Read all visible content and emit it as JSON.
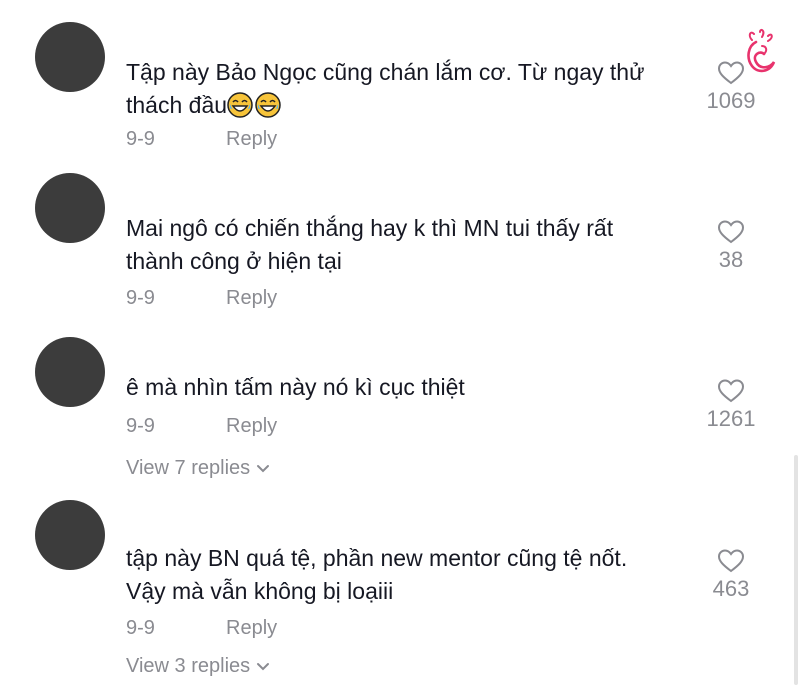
{
  "comments": [
    {
      "text": "Tập này Bảo Ngọc cũng chán lắm cơ. Từ ngay thử\nthách đầu",
      "emojis": [
        "tears-of-joy-emoji",
        "tears-of-joy-emoji"
      ],
      "date": "9-9",
      "reply_label": "Reply",
      "likes": "1069",
      "heart_icon": "heart-outline-icon"
    },
    {
      "text": "Mai ngô có chiến thắng hay k thì MN tui thấy rất\nthành công ở hiện tại",
      "date": "9-9",
      "reply_label": "Reply",
      "likes": "38",
      "heart_icon": "heart-outline-icon"
    },
    {
      "text": "ê mà nhìn tấm này nó kì cục thiệt",
      "date": "9-9",
      "reply_label": "Reply",
      "likes": "1261",
      "heart_icon": "heart-outline-icon",
      "view_replies": "View 7 replies"
    },
    {
      "text": "tập này BN quá tệ, phần new mentor cũng tệ nốt.\nVậy mà vẫn không bị loạiii",
      "date": "9-9",
      "reply_label": "Reply",
      "likes": "463",
      "heart_icon": "heart-outline-icon",
      "view_replies": "View 3 replies"
    }
  ],
  "colors": {
    "text": "#161823",
    "muted": "#8a8b91",
    "avatar": "#3c3c3c",
    "logo": "#e8336d"
  },
  "logo": "lotus-face-logo-icon"
}
